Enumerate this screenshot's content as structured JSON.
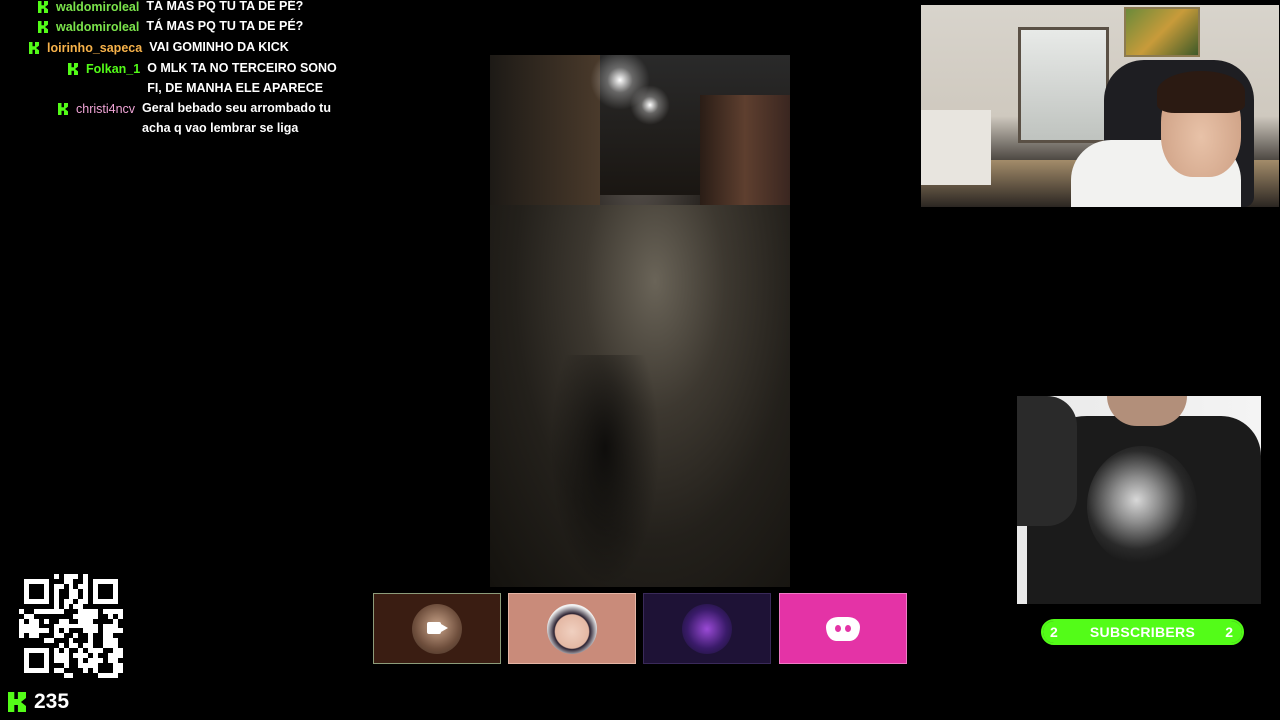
{
  "chat": [
    {
      "user": "waldomiroleal",
      "color": "#7be34b",
      "text": "TÁ MAS PQ TU TA DE PÉ?"
    },
    {
      "user": "waldomiroleal",
      "color": "#7be34b",
      "text": "TÁ MAS PQ TU TA DE PÉ?"
    },
    {
      "user": "loirinho_sapeca",
      "color": "#f7b24a",
      "text": "VAI GOMINHO DA KICK"
    },
    {
      "user": "Folkan_1",
      "color": "#53fc18",
      "text": "O MLK TA NO TERCEIRO SONO FI, DE MANHA ELE APARECE"
    },
    {
      "user": "christi4ncv",
      "color": "#f0a4d6",
      "text": "Geral bebado seu arrombado tu acha q vao lembrar se liga"
    }
  ],
  "viewers": {
    "count": "235"
  },
  "subscribers": {
    "label": "SUBSCRIBERS",
    "current": "2",
    "goal": "2",
    "progress": 1.0
  },
  "tiles": [
    {
      "name": "camera-tile",
      "icon": "video-camera-icon"
    },
    {
      "name": "participant-tile",
      "icon": "avatar"
    },
    {
      "name": "participant-tile-2",
      "icon": "avatar"
    },
    {
      "name": "discord-tile",
      "icon": "discord-icon"
    }
  ],
  "colors": {
    "kick_green": "#53fc18",
    "discord_pink": "#e433a6"
  }
}
